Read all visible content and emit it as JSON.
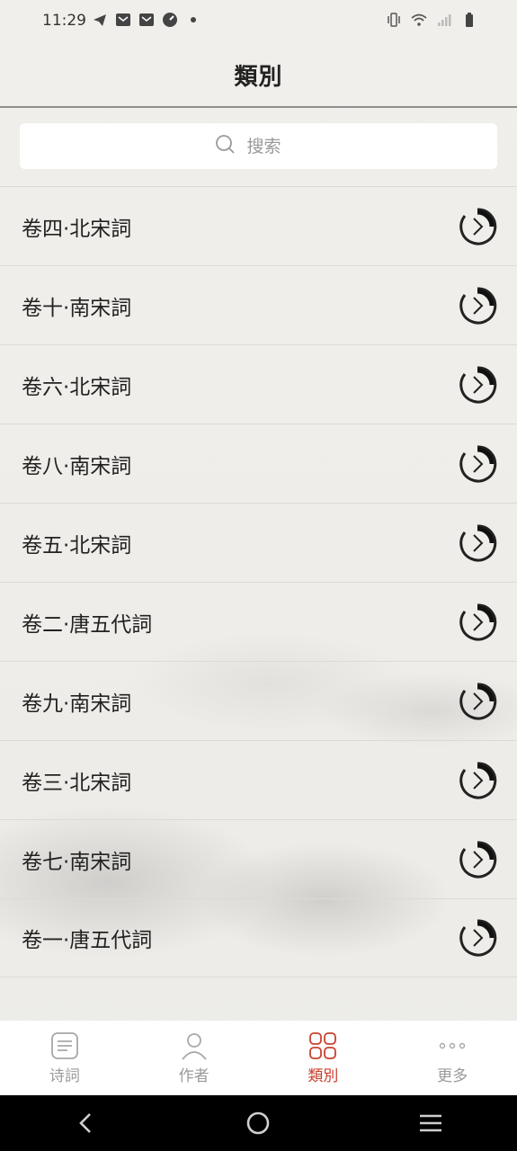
{
  "status_bar": {
    "time": "11:29",
    "left_icons": [
      "telegram-icon",
      "mail-icon",
      "mail-icon",
      "speedometer-icon",
      "dot-icon"
    ],
    "right_icons": [
      "vibrate-icon",
      "wifi-icon",
      "signal-icon",
      "battery-icon"
    ]
  },
  "header": {
    "title": "類別"
  },
  "search": {
    "placeholder": "搜索"
  },
  "categories": [
    {
      "label": "卷四·北宋詞"
    },
    {
      "label": "卷十·南宋詞"
    },
    {
      "label": "卷六·北宋詞"
    },
    {
      "label": "卷八·南宋詞"
    },
    {
      "label": "卷五·北宋詞"
    },
    {
      "label": "卷二·唐五代詞"
    },
    {
      "label": "卷九·南宋詞"
    },
    {
      "label": "卷三·北宋詞"
    },
    {
      "label": "卷七·南宋詞"
    },
    {
      "label": "卷一·唐五代詞"
    }
  ],
  "tabs": [
    {
      "label": "诗詞",
      "icon": "document-list-icon",
      "active": false
    },
    {
      "label": "作者",
      "icon": "person-icon",
      "active": false
    },
    {
      "label": "類別",
      "icon": "category-grid-icon",
      "active": true
    },
    {
      "label": "更多",
      "icon": "more-dots-icon",
      "active": false
    }
  ],
  "colors": {
    "accent": "#c9402e",
    "inactive": "#9a9a9a",
    "background": "#efede9"
  }
}
